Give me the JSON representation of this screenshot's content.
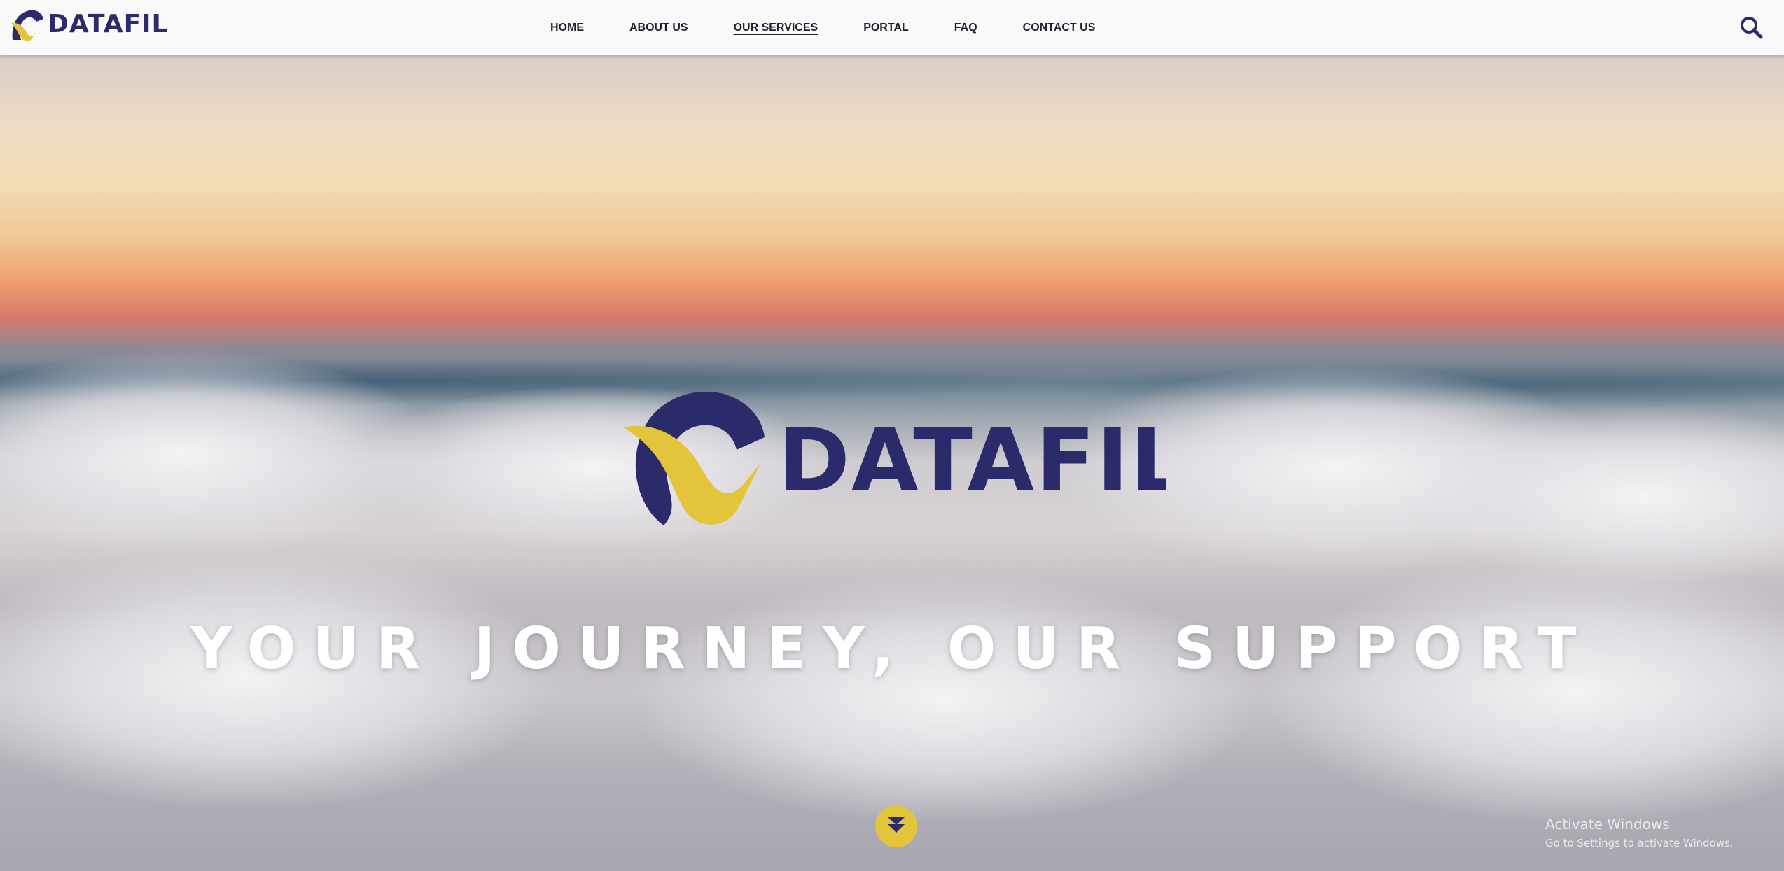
{
  "header": {
    "brand_name": "DATAFIL",
    "nav": [
      {
        "label": "HOME"
      },
      {
        "label": "ABOUT US"
      },
      {
        "label": "OUR SERVICES",
        "active": true
      },
      {
        "label": "PORTAL"
      },
      {
        "label": "FAQ"
      },
      {
        "label": "CONTACT US"
      }
    ],
    "search_icon": "search-icon"
  },
  "hero": {
    "logo_text": "DATAFIL",
    "tagline": "YOUR JOURNEY, OUR SUPPORT",
    "scroll_icon": "double-chevron-down-icon"
  },
  "watermark": {
    "title": "Activate Windows",
    "subtitle": "Go to Settings to activate Windows."
  },
  "colors": {
    "brand_navy": "#2b2a6a",
    "brand_yellow": "#e2c53a",
    "header_bg": "#f9f9f9"
  }
}
